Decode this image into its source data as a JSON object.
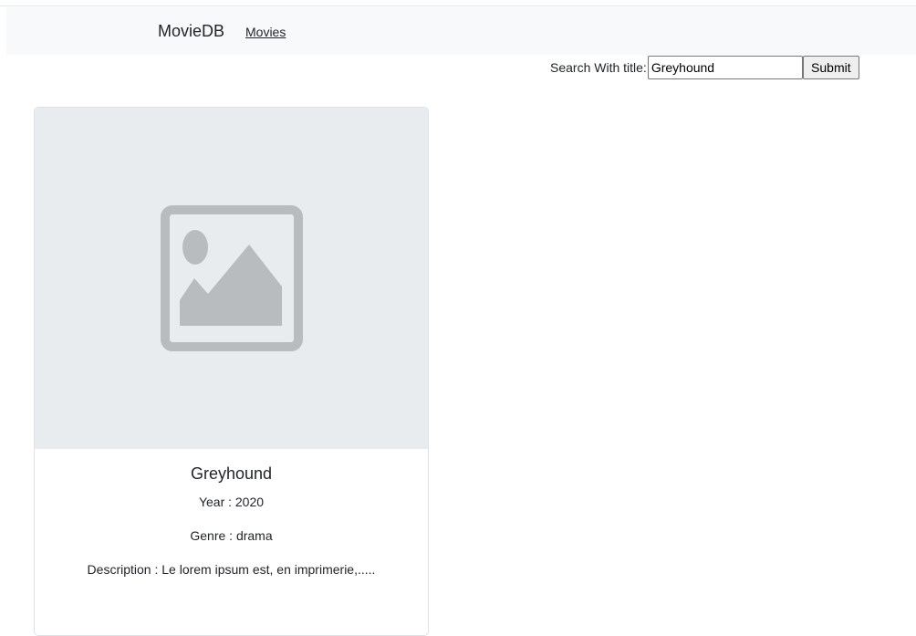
{
  "navbar": {
    "brand": "MovieDB",
    "links": [
      {
        "label": "Movies"
      }
    ]
  },
  "search": {
    "label": "Search With title:",
    "value": "Greyhound",
    "button_label": "Submit"
  },
  "movies": [
    {
      "image_icon": "image-placeholder-icon",
      "title": "Greyhound",
      "year": "Year : 2020",
      "genre": "Genre : drama",
      "description": "Description : Le lorem ipsum est, en imprimerie,....."
    }
  ],
  "colors": {
    "navbar_bg": "#f8f9fa",
    "card_image_bg": "#e9ecef",
    "placeholder_icon": "#b9bcbf",
    "text": "#212529"
  }
}
